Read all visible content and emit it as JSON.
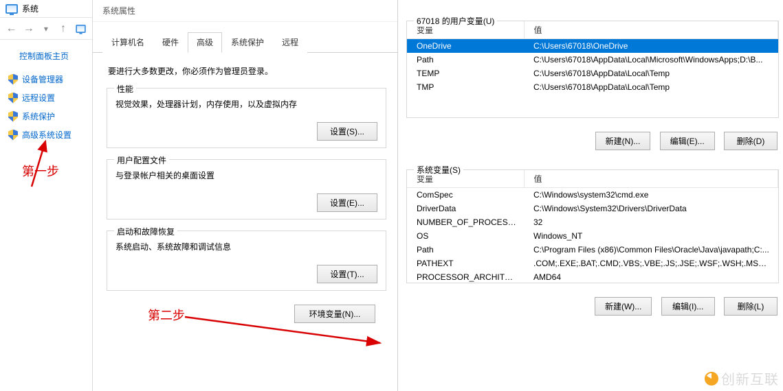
{
  "sys": {
    "title": "系统",
    "home": "控制面板主页",
    "links": [
      "设备管理器",
      "远程设置",
      "系统保护",
      "高级系统设置"
    ],
    "step1": "第一步"
  },
  "props": {
    "title": "系统属性",
    "tabs": [
      "计算机名",
      "硬件",
      "高级",
      "系统保护",
      "远程"
    ],
    "active_tab": 2,
    "note": "要进行大多数更改，你必须作为管理员登录。",
    "perf": {
      "legend": "性能",
      "text": "视觉效果，处理器计划，内存使用，以及虚拟内存",
      "btn": "设置(S)..."
    },
    "profile": {
      "legend": "用户配置文件",
      "text": "与登录帐户相关的桌面设置",
      "btn": "设置(E)..."
    },
    "startup": {
      "legend": "启动和故障恢复",
      "text": "系统启动、系统故障和调试信息",
      "btn": "设置(T)..."
    },
    "envbtn": "环境变量(N)...",
    "step2": "第二步"
  },
  "env": {
    "user_title": "67018 的用户变量(U)",
    "sys_title": "系统变量(S)",
    "col_var": "变量",
    "col_val": "值",
    "user_vars": [
      {
        "name": "OneDrive",
        "value": "C:\\Users\\67018\\OneDrive",
        "selected": true
      },
      {
        "name": "Path",
        "value": "C:\\Users\\67018\\AppData\\Local\\Microsoft\\WindowsApps;D:\\B..."
      },
      {
        "name": "TEMP",
        "value": "C:\\Users\\67018\\AppData\\Local\\Temp"
      },
      {
        "name": "TMP",
        "value": "C:\\Users\\67018\\AppData\\Local\\Temp"
      }
    ],
    "sys_vars": [
      {
        "name": "ComSpec",
        "value": "C:\\Windows\\system32\\cmd.exe"
      },
      {
        "name": "DriverData",
        "value": "C:\\Windows\\System32\\Drivers\\DriverData"
      },
      {
        "name": "NUMBER_OF_PROCESSORS",
        "value": "32"
      },
      {
        "name": "OS",
        "value": "Windows_NT"
      },
      {
        "name": "Path",
        "value": "C:\\Program Files (x86)\\Common Files\\Oracle\\Java\\javapath;C:..."
      },
      {
        "name": "PATHEXT",
        "value": ".COM;.EXE;.BAT;.CMD;.VBS;.VBE;.JS;.JSE;.WSF;.WSH;.MSC;.PY;.P..."
      },
      {
        "name": "PROCESSOR_ARCHITECT...",
        "value": "AMD64"
      }
    ],
    "btn_new_u": "新建(N)...",
    "btn_edit_u": "编辑(E)...",
    "btn_del_u": "删除(D)",
    "btn_new_s": "新建(W)...",
    "btn_edit_s": "编辑(I)...",
    "btn_del_s": "删除(L)"
  },
  "watermark": "创新互联"
}
